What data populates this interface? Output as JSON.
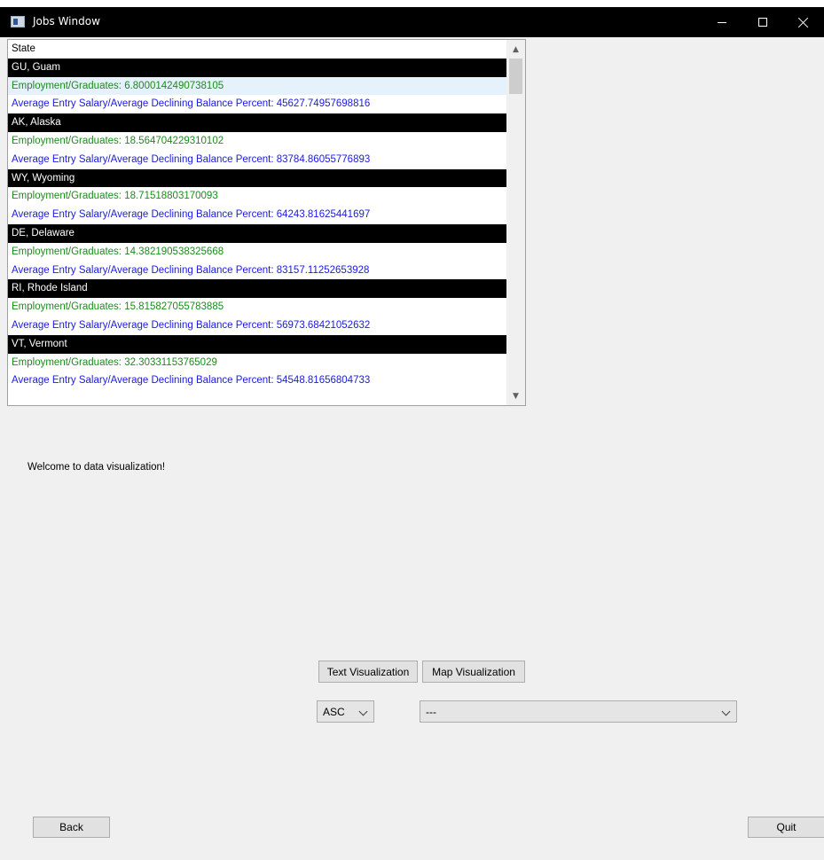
{
  "window": {
    "title": "Jobs Window"
  },
  "listbox": {
    "header": "State",
    "states": [
      {
        "name": "GU, Guam",
        "employment": "Employment/Graduates: 6.8000142490738105",
        "salary": "Average Entry Salary/Average Declining Balance Percent: 45627.74957698816"
      },
      {
        "name": "AK, Alaska",
        "employment": "Employment/Graduates: 18.564704229310102",
        "salary": "Average Entry Salary/Average Declining Balance Percent: 83784.86055776893"
      },
      {
        "name": "WY, Wyoming",
        "employment": "Employment/Graduates: 18.71518803170093",
        "salary": "Average Entry Salary/Average Declining Balance Percent: 64243.81625441697"
      },
      {
        "name": "DE, Delaware",
        "employment": "Employment/Graduates: 14.382190538325668",
        "salary": "Average Entry Salary/Average Declining Balance Percent: 83157.11252653928"
      },
      {
        "name": "RI, Rhode Island",
        "employment": "Employment/Graduates: 15.815827055783885",
        "salary": "Average Entry Salary/Average Declining Balance Percent: 56973.68421052632"
      },
      {
        "name": "VT, Vermont",
        "employment": "Employment/Graduates: 32.30331153765029",
        "salary": "Average Entry Salary/Average Declining Balance Percent: 54548.81656804733"
      }
    ]
  },
  "main": {
    "welcome": "Welcome to data visualization!"
  },
  "buttons": {
    "text_vis": "Text Visualization",
    "map_vis": "Map Visualization",
    "back": "Back",
    "quit": "Quit"
  },
  "combos": {
    "sort_value": "ASC",
    "field_value": "---"
  },
  "colors": {
    "employment_text": "#1e8a1e",
    "salary_text": "#1a1ae6",
    "state_row_bg": "#000000",
    "window_bg": "#f0f0f0"
  }
}
